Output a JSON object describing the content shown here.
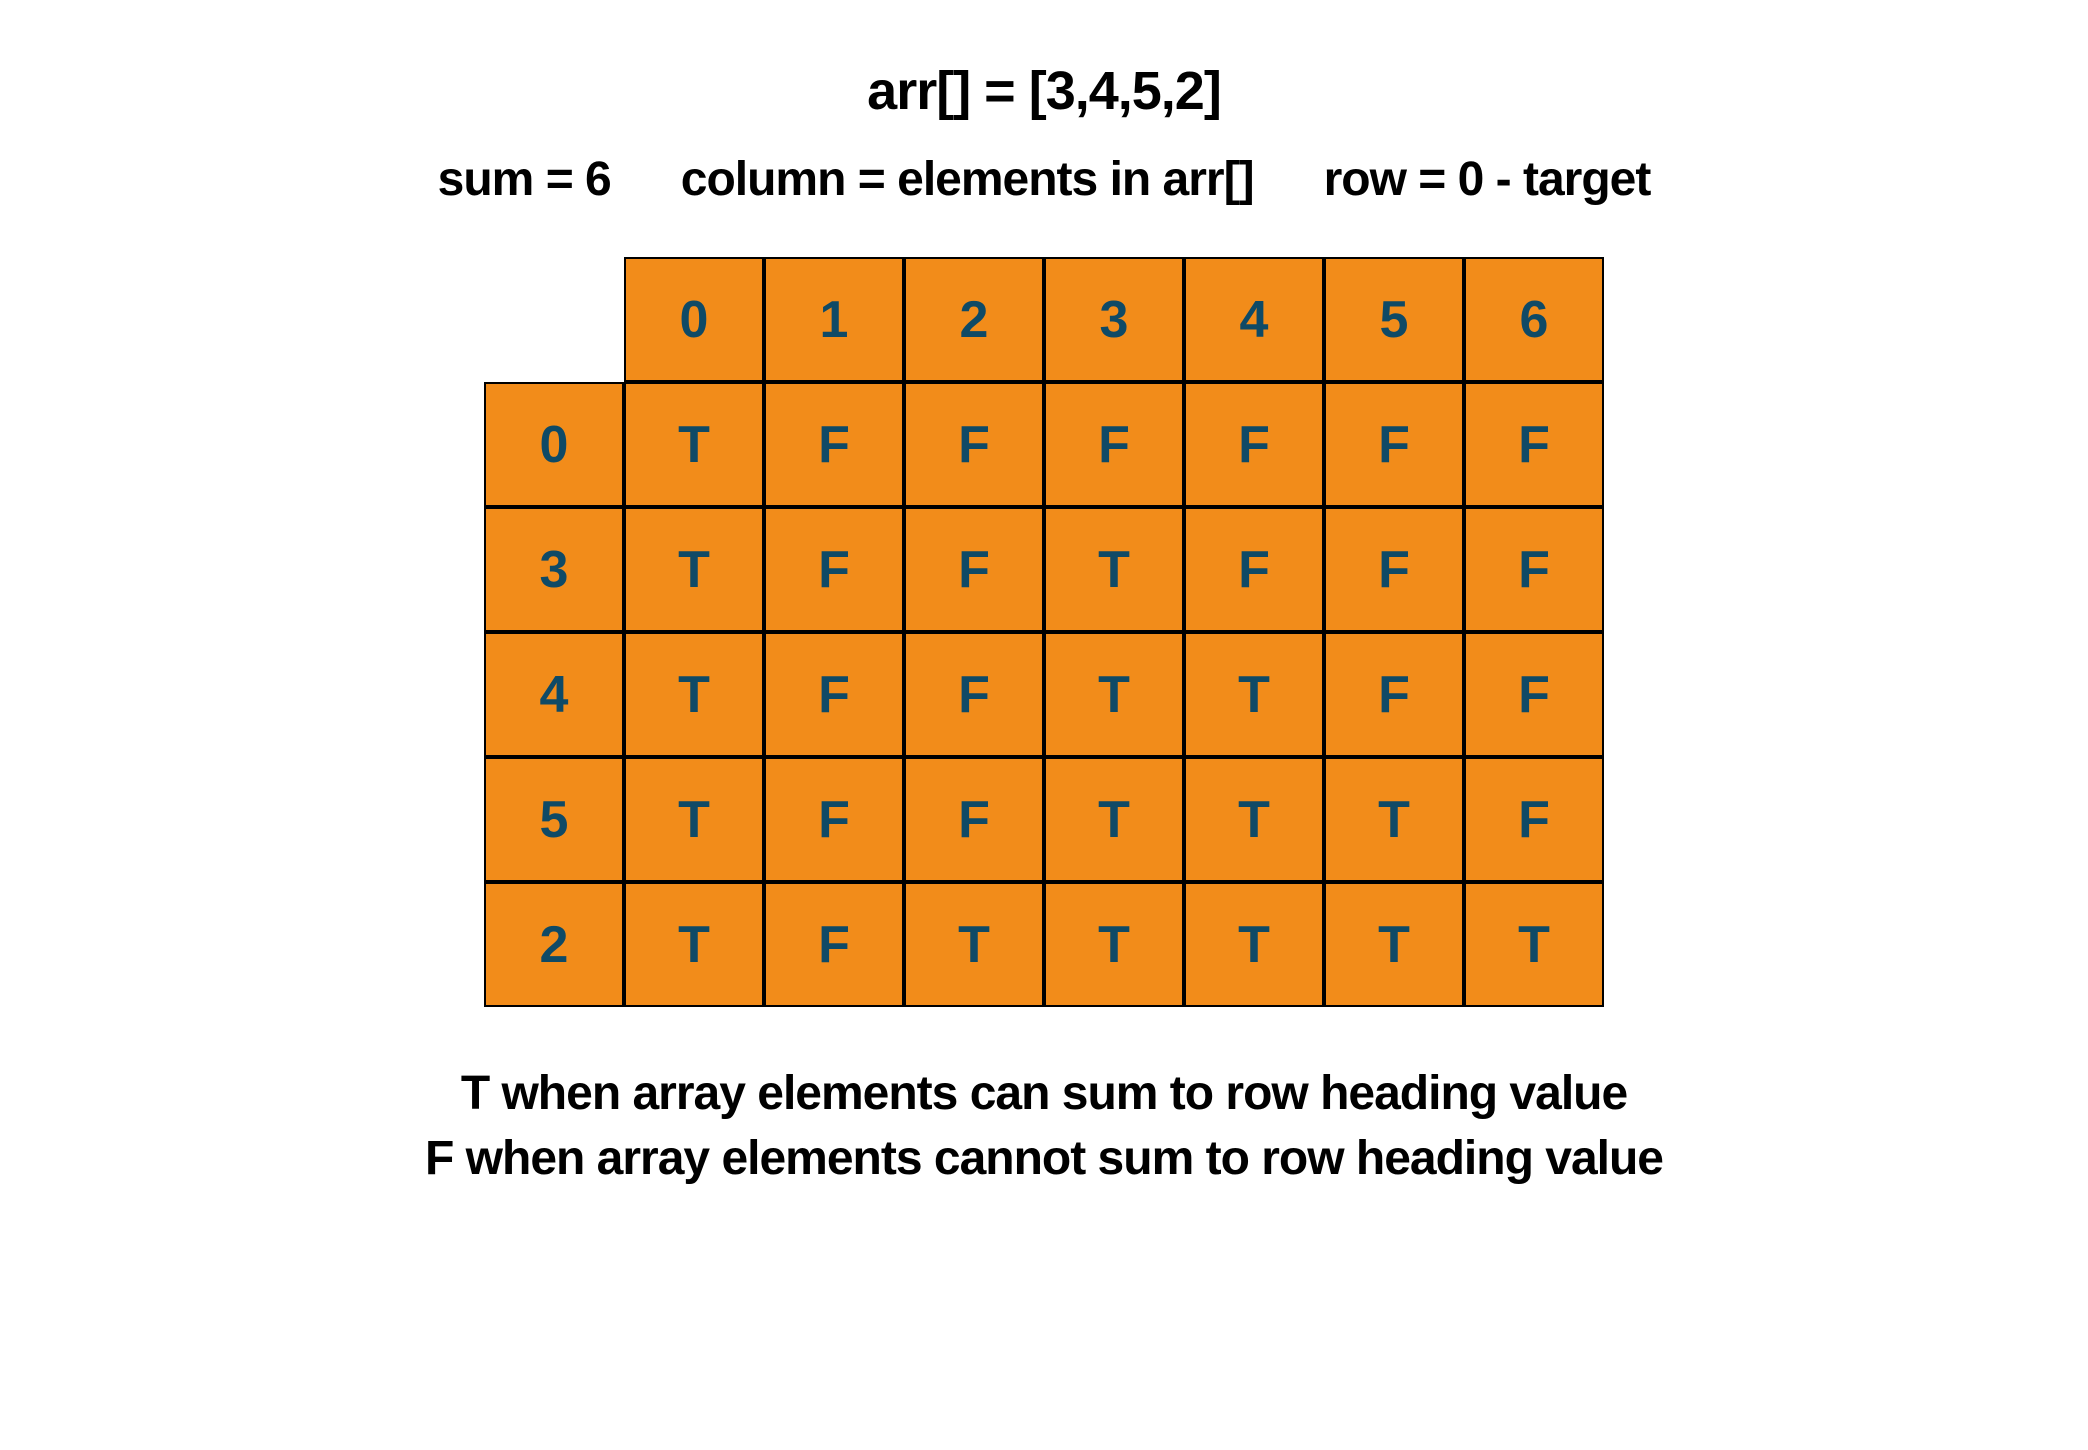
{
  "title": "arr[] = [3,4,5,2]",
  "subtitle": {
    "sum": "sum = 6",
    "column": "column = elements in arr[]",
    "row": "row = 0 - target"
  },
  "chart_data": {
    "type": "table",
    "col_headers": [
      "0",
      "1",
      "2",
      "3",
      "4",
      "5",
      "6"
    ],
    "row_headers": [
      "0",
      "3",
      "4",
      "5",
      "2"
    ],
    "rows": [
      [
        "T",
        "F",
        "F",
        "F",
        "F",
        "F",
        "F"
      ],
      [
        "T",
        "F",
        "F",
        "T",
        "F",
        "F",
        "F"
      ],
      [
        "T",
        "F",
        "F",
        "T",
        "T",
        "F",
        "F"
      ],
      [
        "T",
        "F",
        "F",
        "T",
        "T",
        "T",
        "F"
      ],
      [
        "T",
        "F",
        "T",
        "T",
        "T",
        "T",
        "T"
      ]
    ],
    "cell_color": "#f28c1a",
    "text_color": "#0f4a66"
  },
  "footer": {
    "line1": "T when array elements can sum to row heading value",
    "line2": "F when array elements cannot sum to row heading value"
  }
}
